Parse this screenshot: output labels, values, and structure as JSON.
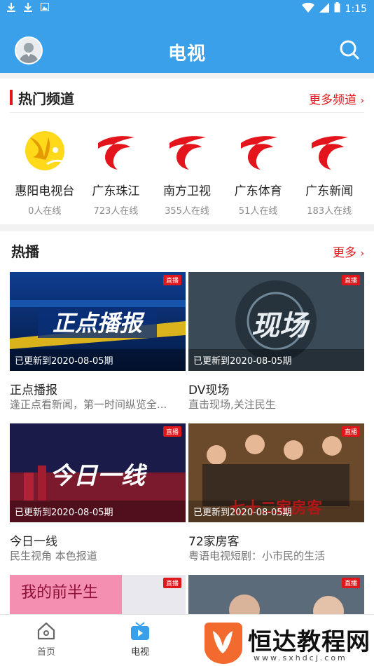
{
  "status_bar": {
    "time": "1:15",
    "icons": [
      "download-icon",
      "download-icon",
      "image-icon",
      "wifi-icon",
      "signal-icon",
      "battery-icon"
    ]
  },
  "header": {
    "title": "电视",
    "avatar": "avatar",
    "search_icon": "search-icon"
  },
  "hot_channels": {
    "title": "热门频道",
    "more": "更多频道",
    "items": [
      {
        "name": "惠阳电视台",
        "online": "0人在线",
        "logo": "huiyang-logo"
      },
      {
        "name": "广东珠江",
        "online": "723人在线",
        "logo": "gdtv-logo"
      },
      {
        "name": "南方卫视",
        "online": "355人在线",
        "logo": "gdtv-logo"
      },
      {
        "name": "广东体育",
        "online": "51人在线",
        "logo": "gdtv-logo"
      },
      {
        "name": "广东新闻",
        "online": "183人在线",
        "logo": "gdtv-logo"
      }
    ]
  },
  "hot_shows": {
    "title": "热播",
    "more": "更多",
    "badge": "直播",
    "items": [
      {
        "title": "正点播报",
        "desc": "逢正点看新闻，第一时间纵览全...",
        "update": "已更新到2020-08-05期",
        "thumb_text": "正点播报"
      },
      {
        "title": "DV现场",
        "desc": "直击现场,关注民生",
        "update": "已更新到2020-08-05期",
        "thumb_text": "现场"
      },
      {
        "title": "今日一线",
        "desc": "民生视角 本色报道",
        "update": "已更新到2020-08-05期",
        "thumb_text": "今日一线"
      },
      {
        "title": "72家房客",
        "desc": "粤语电视短剧：小市民的生活",
        "update": "已更新到2020-08-05期",
        "thumb_text": "七十二家房客"
      }
    ],
    "partial_thumbs": [
      "我的前半生",
      ""
    ]
  },
  "bottom_nav": {
    "items": [
      {
        "label": "首页",
        "icon": "home-icon",
        "active": false
      },
      {
        "label": "电视",
        "icon": "tv-icon",
        "active": true
      }
    ]
  },
  "watermark": {
    "text": "恒达教程网",
    "url": "www.sxhdcj.com"
  },
  "colors": {
    "accent": "#3aa0ea",
    "red": "#e0161a"
  }
}
